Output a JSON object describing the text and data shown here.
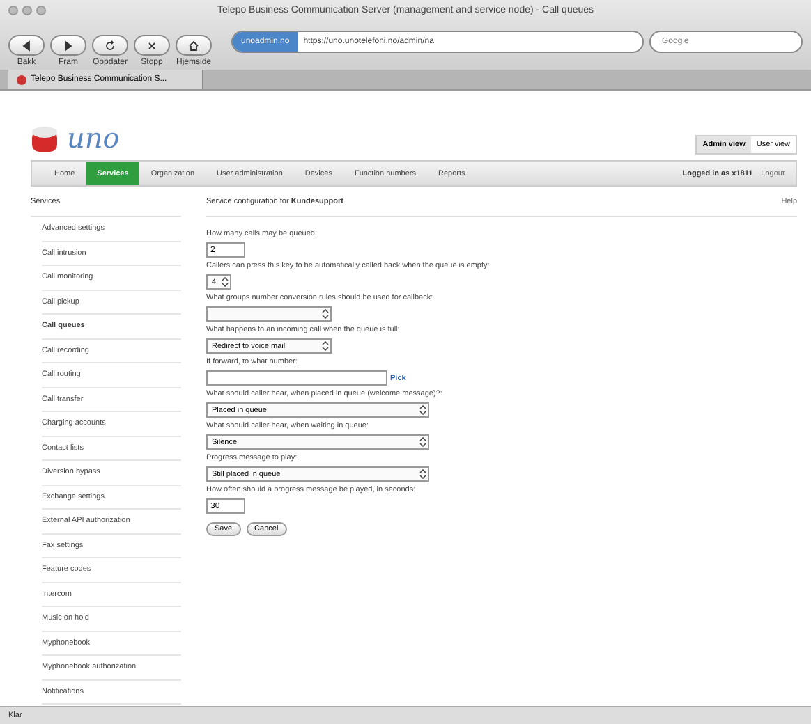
{
  "window": {
    "title": "Telepo Business Communication Server (management and service node) - Call queues"
  },
  "toolbar": [
    {
      "label": "Bakk",
      "kind": "back"
    },
    {
      "label": "Fram",
      "kind": "forward"
    },
    {
      "label": "Oppdater",
      "kind": "reload"
    },
    {
      "label": "Stopp",
      "kind": "stop"
    },
    {
      "label": "Hjemside",
      "kind": "home"
    }
  ],
  "address": {
    "site": "unoadmin.no",
    "url": "https://uno.unotelefoni.no/admin/na"
  },
  "search": {
    "placeholder": "Google"
  },
  "browser_tabs": [
    {
      "label": "Telepo Business Communication S...",
      "selected": true
    }
  ],
  "logo": {
    "text": "uno"
  },
  "view_switch": [
    {
      "label": "Admin view",
      "selected": true
    },
    {
      "label": "User view",
      "selected": false
    }
  ],
  "nav": [
    {
      "label": "Home",
      "selected": false
    },
    {
      "label": "Services",
      "selected": true
    },
    {
      "label": "Organization",
      "selected": false
    },
    {
      "label": "User administration",
      "selected": false
    },
    {
      "label": "Devices",
      "selected": false
    },
    {
      "label": "Function numbers",
      "selected": false
    },
    {
      "label": "Reports",
      "selected": false
    }
  ],
  "login": {
    "text": "Logged in as x1811",
    "logout": "Logout"
  },
  "sidebar": {
    "title": "Services",
    "items": [
      {
        "label": "Advanced settings",
        "selected": false
      },
      {
        "label": "Call intrusion",
        "selected": false
      },
      {
        "label": "Call monitoring",
        "selected": false
      },
      {
        "label": "Call pickup",
        "selected": false
      },
      {
        "label": "Call queues",
        "selected": true
      },
      {
        "label": "Call recording",
        "selected": false
      },
      {
        "label": "Call routing",
        "selected": false
      },
      {
        "label": "Call transfer",
        "selected": false
      },
      {
        "label": "Charging accounts",
        "selected": false
      },
      {
        "label": "Contact lists",
        "selected": false
      },
      {
        "label": "Diversion bypass",
        "selected": false
      },
      {
        "label": "Exchange settings",
        "selected": false
      },
      {
        "label": "External API authorization",
        "selected": false
      },
      {
        "label": "Fax settings",
        "selected": false
      },
      {
        "label": "Feature codes",
        "selected": false
      },
      {
        "label": "Intercom",
        "selected": false
      },
      {
        "label": "Music on hold",
        "selected": false
      },
      {
        "label": "Myphonebook",
        "selected": false
      },
      {
        "label": "Myphonebook authorization",
        "selected": false
      },
      {
        "label": "Notifications",
        "selected": false
      }
    ]
  },
  "content": {
    "title": "Service configuration for **Kundesupport**",
    "help": "Help",
    "fields": [
      {
        "kind": "text",
        "label": "How many calls may be queued:",
        "value": "2"
      },
      {
        "kind": "keypicker",
        "label": "Callers can press this key to be automatically called back when the queue is empty:",
        "value": "4"
      },
      {
        "kind": "select",
        "label": "What groups number conversion rules should be used for callback:"
      },
      {
        "kind": "select",
        "label": "What happens to an incoming call when the queue is full:",
        "value": "Redirect to voice mail"
      },
      {
        "kind": "pick",
        "label": "If forward, to what number:",
        "link": "Pick"
      },
      {
        "kind": "longselect",
        "label": "What should caller hear, when placed in queue (welcome message)?:",
        "value": "Placed in queue"
      },
      {
        "kind": "longselect",
        "label": "What should caller hear, when waiting in queue:",
        "value": "Silence"
      },
      {
        "kind": "longselect",
        "label": "Progress message to play:",
        "value": "Still placed in queue"
      },
      {
        "kind": "text",
        "label": "How often should a progress message be played, in seconds:",
        "value": "30"
      }
    ],
    "buttons": [
      "Save",
      "Cancel"
    ]
  },
  "status_bar": {
    "text": "Klar"
  }
}
